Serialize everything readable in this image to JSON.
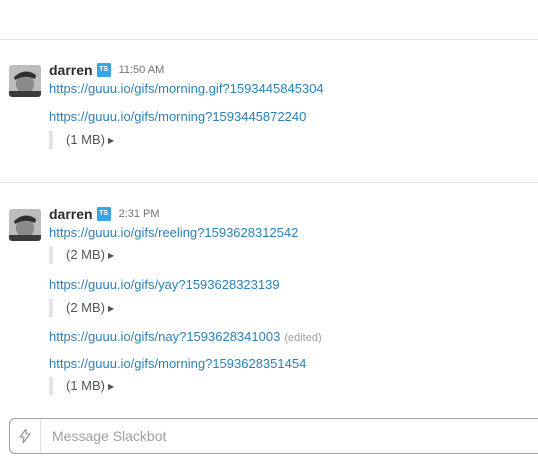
{
  "messages": [
    {
      "author": "darren",
      "badge": "TS",
      "time": "11:50 AM",
      "items": [
        {
          "link": "https://guuu.io/gifs/morning.gif?1593445845304"
        },
        {
          "link": "https://guuu.io/gifs/morning?1593445872240",
          "size": "(1 MB)"
        }
      ]
    },
    {
      "author": "darren",
      "badge": "TS",
      "time": "2:31 PM",
      "items": [
        {
          "link": "https://guuu.io/gifs/reeling?1593628312542",
          "size": "(2 MB)"
        },
        {
          "link": "https://guuu.io/gifs/yay?1593628323139",
          "size": "(2 MB)"
        },
        {
          "link": "https://guuu.io/gifs/nay?1593628341003",
          "edited": "(edited)"
        },
        {
          "link": "https://guuu.io/gifs/morning?1593628351454",
          "size": "(1 MB)"
        }
      ]
    }
  ],
  "composer": {
    "placeholder": "Message Slackbot",
    "icon": "lightning-icon"
  },
  "colors": {
    "link": "#2a80b9",
    "badge": "#3aa3e3",
    "text": "#2c2d30",
    "muted": "#717274"
  }
}
